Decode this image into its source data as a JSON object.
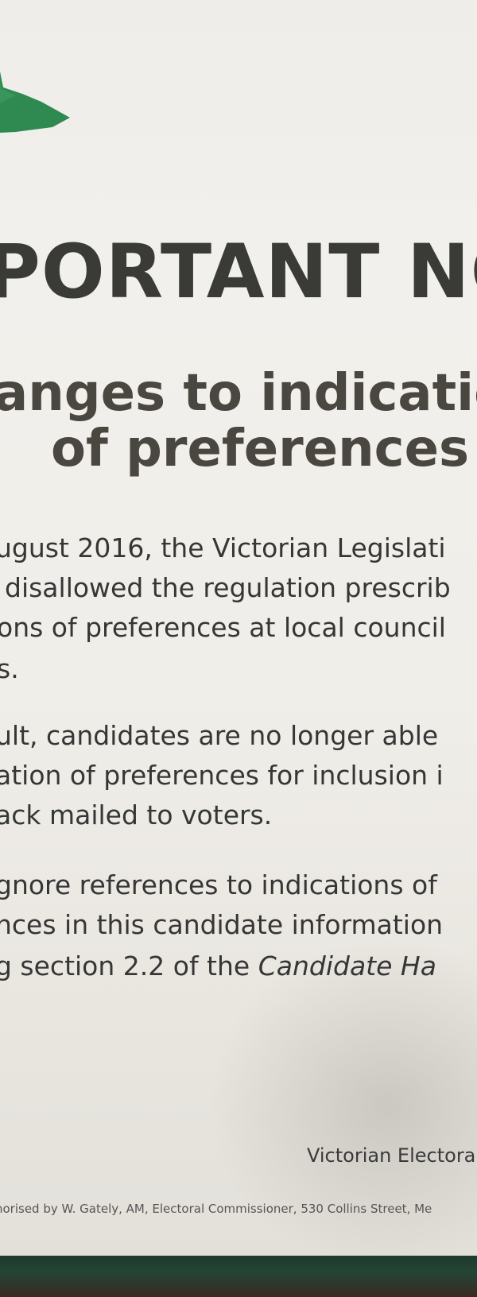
{
  "notice": {
    "title": "PORTANT NOT",
    "subtitle_line1": "anges to indication",
    "subtitle_line2": "of preferences"
  },
  "body": {
    "para1": [
      "ugust 2016, the Victorian Legislati",
      "disallowed the regulation prescrib",
      "ons of preferences at local council",
      "s."
    ],
    "para2": [
      "ult, candidates are no longer able",
      "ation of preferences for inclusion i",
      "ack mailed to voters."
    ],
    "para3": [
      "gnore references to indications of",
      "nces in this candidate information"
    ],
    "para3_last_prefix": "g section 2.2 of the ",
    "para3_last_italic": "Candidate Ha"
  },
  "signature": "Victorian Electora",
  "footer": "norised by W. Gately, AM, Electoral Commissioner, 530 Collins Street, Me",
  "colors": {
    "logo_green": "#2f8a52",
    "title_text": "#3a3a36",
    "paper": "#efede9",
    "bottom_band": "#1e3a2c"
  }
}
